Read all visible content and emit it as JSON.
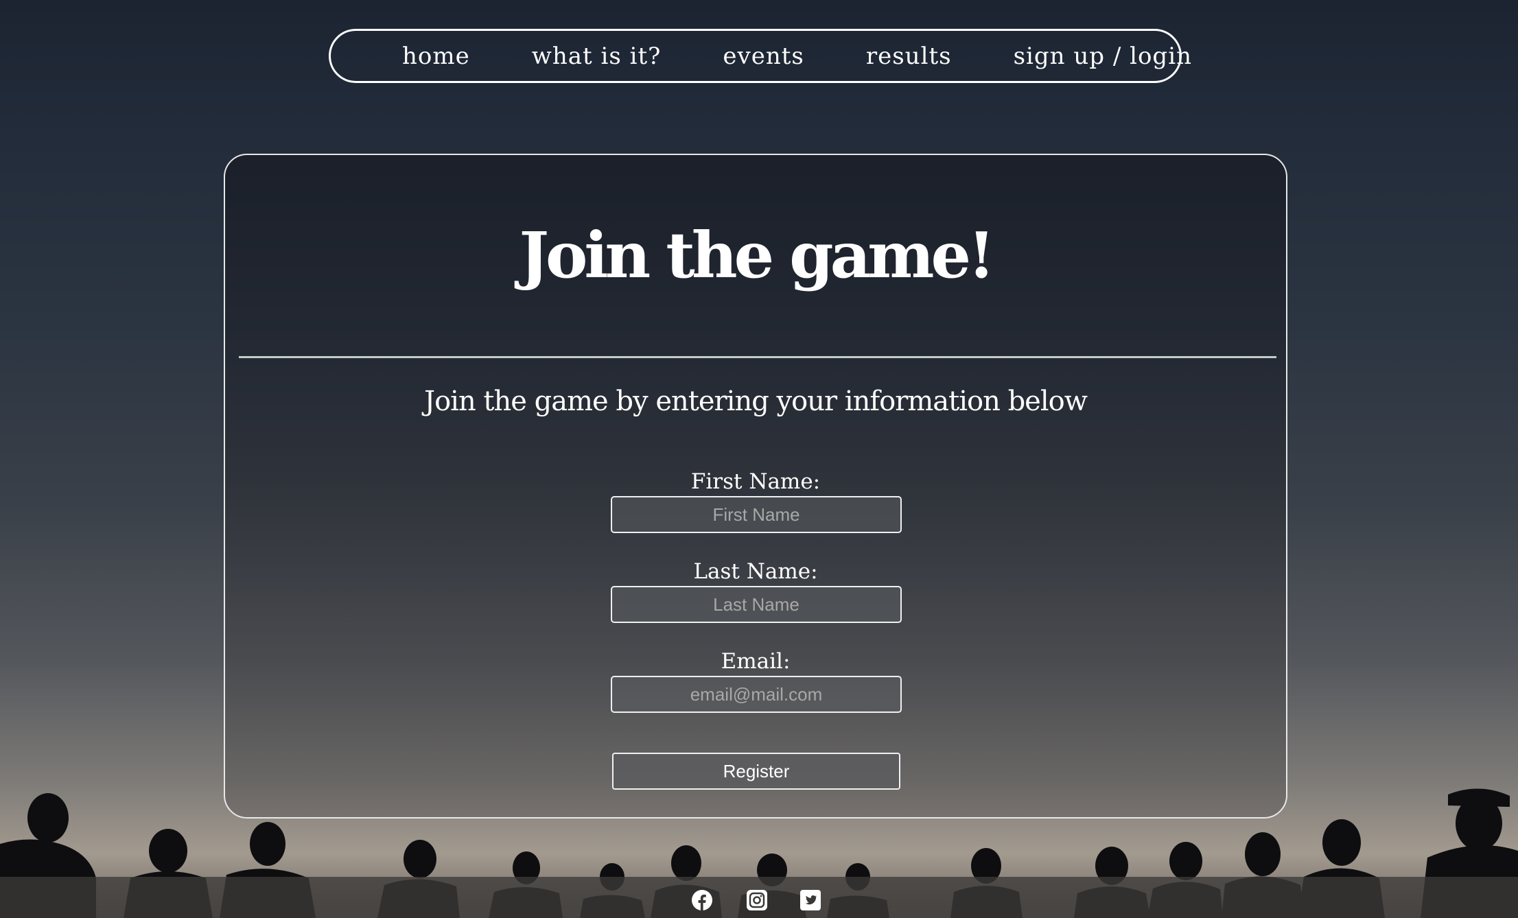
{
  "nav": {
    "items": [
      {
        "label": "home"
      },
      {
        "label": "what is it?"
      },
      {
        "label": "events"
      },
      {
        "label": "results"
      },
      {
        "label": "sign up / login"
      }
    ]
  },
  "card": {
    "title": "Join the game!",
    "subtitle": "Join the game by entering your information below"
  },
  "form": {
    "first_name": {
      "label": "First Name:",
      "placeholder": "First Name",
      "value": ""
    },
    "last_name": {
      "label": "Last Name:",
      "placeholder": "Last Name",
      "value": ""
    },
    "email": {
      "label": "Email:",
      "placeholder": "email@mail.com",
      "value": ""
    },
    "register_label": "Register"
  },
  "footer": {
    "icons": [
      "facebook-icon",
      "instagram-icon",
      "twitter-icon"
    ]
  },
  "colors": {
    "text": "#ffffff",
    "border": "#ffffff",
    "placeholder": "#a8a8a8"
  }
}
